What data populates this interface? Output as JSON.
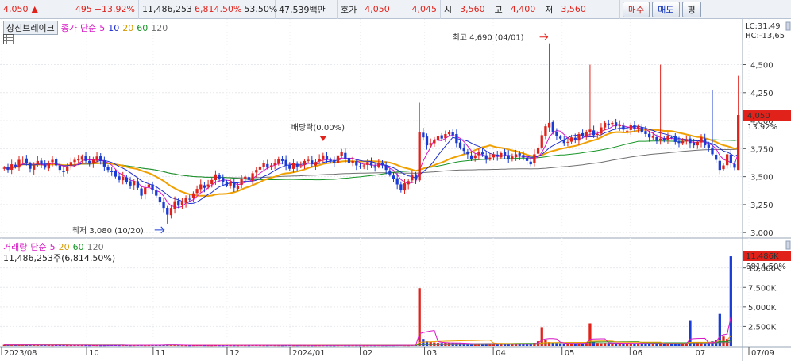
{
  "topbar": {
    "price": "4,050",
    "change_arrow": "▲",
    "change": "495",
    "change_pct": "+13.92%",
    "volume": "11,486,253",
    "volume_ratio": "6,814.50%",
    "turnover_pct": "53.50%",
    "amount": "47,539백만",
    "quote_label": "호가",
    "ask": "4,050",
    "bid": "4,045",
    "open_label": "시",
    "open": "3,560",
    "high_label": "고",
    "high": "4,400",
    "low_label": "저",
    "low": "3,560",
    "buy_label": "매수",
    "sell_label": "매도",
    "avg_label": "평"
  },
  "price_legend": {
    "stock_name": "상신브레이크",
    "kind": "종가",
    "method": "단순",
    "periods": [
      "5",
      "10",
      "20",
      "60",
      "120"
    ]
  },
  "volume_legend": {
    "title": "거래량",
    "method": "단순",
    "periods": [
      "5",
      "20",
      "60",
      "120"
    ],
    "value": "11,486,253주(6,814.50%)"
  },
  "right_info": {
    "lc": "LC:31,49",
    "hc": "HC:-13,65"
  },
  "colors": {
    "up": "#e0221b",
    "down": "#1a3cd6",
    "ma5": "#d817c6",
    "ma10": "#1f2fd0",
    "ma20": "#f0a000",
    "ma60": "#189628",
    "ma120": "#707070",
    "badge": "#e0221b"
  },
  "chart_data": {
    "type": "candlestick",
    "x_ticks": [
      "2023/08",
      "10",
      "11",
      "12",
      "2024/01",
      "02",
      "03",
      "04",
      "05",
      "06",
      "07",
      "07/09"
    ],
    "price_axis": {
      "ticks": [
        "4,500",
        "4,250",
        "4,000",
        "3,750",
        "3,500",
        "3,250",
        "3,000"
      ],
      "ylim": [
        2980,
        4780
      ]
    },
    "volume_axis": {
      "ticks": [
        "10,000K",
        "7,500K",
        "5,000K",
        "2,500K"
      ],
      "ylim": [
        0,
        12000
      ]
    },
    "current_price": {
      "label": "4,050",
      "pct": "13.92%"
    },
    "current_volume": {
      "label": "11,486K",
      "pct": "6814.50%"
    },
    "annotations": {
      "high": "최고 4,690 (04/01)",
      "low": "최저 3,080 (10/20)",
      "dividend": "배당락(0.00%)"
    },
    "closes": [
      3580,
      3560,
      3610,
      3590,
      3650,
      3660,
      3620,
      3570,
      3600,
      3640,
      3610,
      3580,
      3620,
      3650,
      3600,
      3560,
      3540,
      3590,
      3630,
      3650,
      3660,
      3680,
      3640,
      3620,
      3650,
      3680,
      3640,
      3590,
      3560,
      3540,
      3500,
      3470,
      3500,
      3450,
      3420,
      3460,
      3400,
      3330,
      3400,
      3430,
      3380,
      3330,
      3270,
      3220,
      3160,
      3220,
      3280,
      3240,
      3270,
      3310,
      3300,
      3350,
      3390,
      3430,
      3400,
      3430,
      3470,
      3520,
      3480,
      3450,
      3420,
      3450,
      3400,
      3420,
      3480,
      3500,
      3470,
      3530,
      3560,
      3590,
      3620,
      3580,
      3600,
      3620,
      3660,
      3640,
      3600,
      3570,
      3620,
      3590,
      3600,
      3640,
      3650,
      3610,
      3630,
      3660,
      3690,
      3660,
      3640,
      3620,
      3690,
      3720,
      3660,
      3620,
      3640,
      3600,
      3590,
      3600,
      3630,
      3600,
      3580,
      3620,
      3600,
      3560,
      3520,
      3480,
      3430,
      3380,
      3440,
      3460,
      3520,
      3470,
      3900,
      3850,
      3780,
      3800,
      3830,
      3860,
      3840,
      3880,
      3900,
      3870,
      3800,
      3760,
      3730,
      3700,
      3660,
      3690,
      3720,
      3700,
      3650,
      3670,
      3700,
      3680,
      3710,
      3690,
      3660,
      3680,
      3700,
      3690,
      3670,
      3640,
      3610,
      3700,
      3760,
      3870,
      3950,
      3980,
      3900,
      3860,
      3840,
      3800,
      3810,
      3850,
      3830,
      3880,
      3860,
      3900,
      3920,
      3870,
      3880,
      3940,
      3980,
      3960,
      3980,
      3950,
      3960,
      3920,
      3910,
      3960,
      3930,
      3950,
      3900,
      3880,
      3850,
      3860,
      3820,
      3840,
      3830,
      3860,
      3850,
      3810,
      3800,
      3820,
      3830,
      3800,
      3780,
      3810,
      3850,
      3780,
      3760,
      3700,
      3650,
      3560,
      3600,
      3700,
      3620,
      3580,
      4050
    ],
    "volumes": [
      150,
      120,
      130,
      110,
      140,
      160,
      130,
      120,
      110,
      100,
      120,
      110,
      100,
      90,
      120,
      110,
      100,
      90,
      95,
      100,
      110,
      95,
      90,
      85,
      100,
      90,
      80,
      85,
      95,
      110,
      100,
      90,
      95,
      100,
      85,
      90,
      110,
      100,
      90,
      95,
      100,
      110,
      120,
      130,
      150,
      120,
      100,
      95,
      90,
      85,
      80,
      90,
      95,
      100,
      90,
      85,
      80,
      90,
      85,
      80,
      95,
      90,
      85,
      80,
      100,
      90,
      85,
      110,
      100,
      95,
      90,
      85,
      100,
      90,
      85,
      80,
      90,
      95,
      85,
      80,
      90,
      85,
      80,
      75,
      80,
      85,
      90,
      85,
      80,
      75,
      90,
      100,
      85,
      80,
      90,
      85,
      80,
      75,
      80,
      85,
      80,
      90,
      85,
      80,
      90,
      85,
      95,
      100,
      90,
      85,
      110,
      100,
      7400,
      900,
      600,
      500,
      450,
      400,
      380,
      420,
      400,
      380,
      350,
      330,
      300,
      280,
      260,
      270,
      290,
      300,
      280,
      260,
      250,
      240,
      250,
      260,
      240,
      230,
      250,
      240,
      230,
      220,
      260,
      400,
      600,
      2400,
      800,
      500,
      400,
      350,
      330,
      320,
      300,
      330,
      310,
      350,
      320,
      400,
      2900,
      500,
      400,
      380,
      400,
      370,
      360,
      350,
      340,
      330,
      360,
      340,
      330,
      320,
      310,
      300,
      290,
      300,
      310,
      300,
      290,
      280,
      300,
      290,
      280,
      270,
      300,
      3300,
      500,
      400,
      350,
      330,
      400,
      600,
      800,
      4100,
      1200,
      900,
      11486
    ]
  }
}
